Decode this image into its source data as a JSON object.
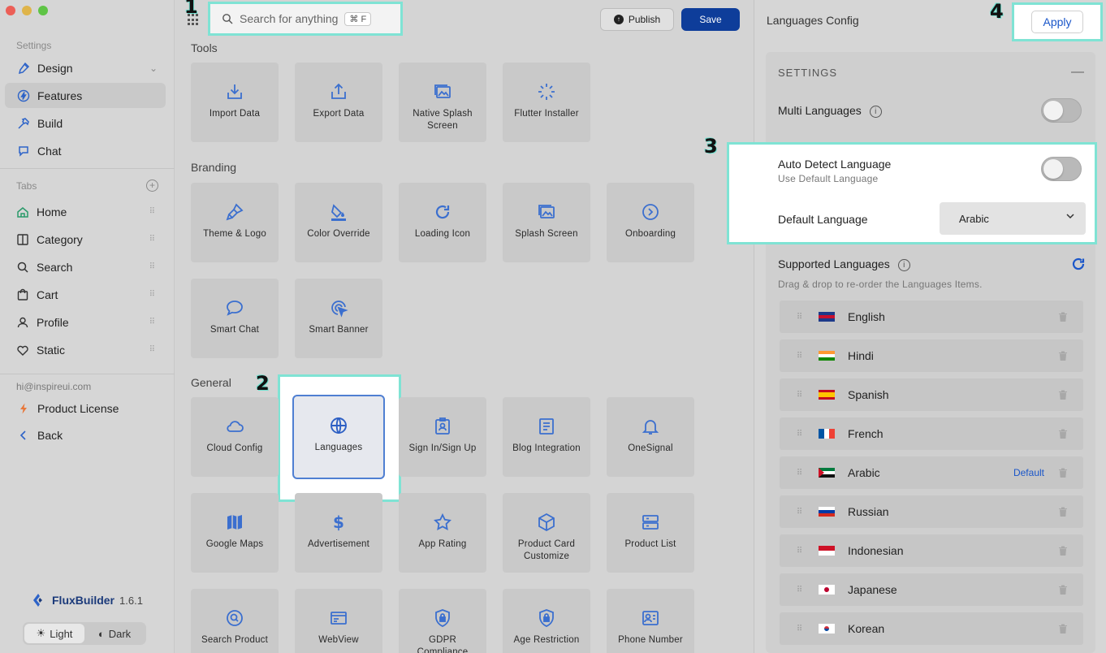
{
  "sidebar": {
    "settings_label": "Settings",
    "items": [
      {
        "label": "Design",
        "icon": "brush-icon"
      },
      {
        "label": "Features",
        "icon": "bolt-icon"
      },
      {
        "label": "Build",
        "icon": "hammer-icon"
      },
      {
        "label": "Chat",
        "icon": "chat-icon"
      }
    ],
    "tabs_label": "Tabs",
    "tabs": [
      {
        "label": "Home",
        "icon": "home-icon"
      },
      {
        "label": "Category",
        "icon": "category-icon"
      },
      {
        "label": "Search",
        "icon": "search-icon"
      },
      {
        "label": "Cart",
        "icon": "cart-icon"
      },
      {
        "label": "Profile",
        "icon": "user-icon"
      },
      {
        "label": "Static",
        "icon": "heart-icon"
      }
    ],
    "email": "hi@inspireui.com",
    "license_label": "Product License",
    "back_label": "Back",
    "brand_name": "FluxBuilder",
    "version": "1.6.1",
    "theme_light": "Light",
    "theme_dark": "Dark"
  },
  "toolbar": {
    "search_placeholder": "Search for anything",
    "search_shortcut": "⌘ F",
    "publish_label": "Publish",
    "save_label": "Save"
  },
  "groups": {
    "tools_title": "Tools",
    "tools": [
      "Import Data",
      "Export Data",
      "Native Splash Screen",
      "Flutter Installer"
    ],
    "branding_title": "Branding",
    "branding": [
      "Theme & Logo",
      "Color Override",
      "Loading Icon",
      "Splash Screen",
      "Onboarding",
      "Smart Chat",
      "Smart Banner"
    ],
    "general_title": "General",
    "general": [
      "Cloud Config",
      "Languages",
      "Sign In/Sign Up",
      "Blog Integration",
      "OneSignal",
      "Google Maps",
      "Advertisement",
      "App Rating",
      "Product Card Customize",
      "Product List",
      "Search Product",
      "WebView",
      "GDPR Compliance",
      "Age Restriction",
      "Phone Number"
    ]
  },
  "markers": [
    "1",
    "2",
    "3",
    "4"
  ],
  "right_panel": {
    "title": "Languages Config",
    "apply_label": "Apply",
    "settings_heading": "SETTINGS",
    "collapse_symbol": "—",
    "multi_languages_label": "Multi Languages",
    "multi_languages_on": false,
    "auto_detect_label": "Auto Detect Language",
    "auto_detect_sub": "Use Default Language",
    "auto_detect_on": false,
    "default_language_label": "Default Language",
    "default_language_value": "Arabic",
    "supported_label": "Supported Languages",
    "supported_hint": "Drag & drop to re-order the Languages Items.",
    "default_badge": "Default",
    "languages": [
      "English",
      "Hindi",
      "Spanish",
      "French",
      "Arabic",
      "Russian",
      "Indonesian",
      "Japanese",
      "Korean"
    ]
  },
  "colors": {
    "accent": "#1a56c9",
    "save_bg": "#0e3d9a",
    "highlight": "#7fe3d4",
    "icon_blue": "#3b6fcf"
  }
}
